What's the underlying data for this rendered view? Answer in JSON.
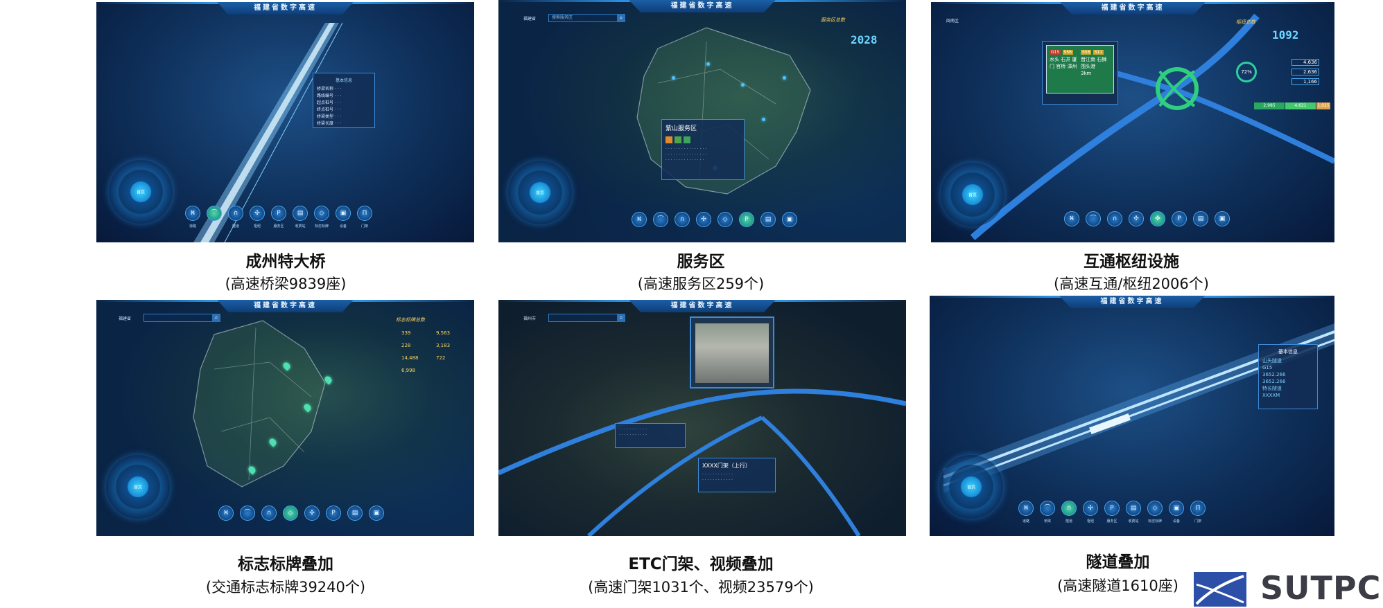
{
  "app_title": "福建省数字高速",
  "panels": [
    {
      "caption_title": "成州特大桥",
      "caption_sub": "(高速桥梁9839座)",
      "toolbar": [
        "道路",
        "桥梁",
        "隧道",
        "枢纽",
        "服务区",
        "收费站",
        "标志标牌",
        "设备",
        "门架"
      ]
    },
    {
      "caption_title": "服务区",
      "caption_sub": "(高速服务区259个)",
      "region": "福建省",
      "search_placeholder": "搜索服务区",
      "stat_title": "服务区总数",
      "stat_value": "2028",
      "popup_title": "紫山服务区"
    },
    {
      "caption_title": "互通枢纽设施",
      "caption_sub": "(高速互通/枢纽2006个)",
      "region": "闽南区",
      "stat_title": "枢纽总数",
      "stat_value": "1092",
      "sign_codes": [
        "G15",
        "S56",
        "S58",
        "S11"
      ],
      "sign_text_left": "水头 石井 厦门 官桥 漳州",
      "sign_text_right": "晋江南 石狮 围头港",
      "sign_distance": "3km",
      "gauge": "72%",
      "counts": [
        "4,636",
        "2,636",
        "1,166"
      ],
      "bottom_bars": [
        "2,985",
        "4,621",
        "1,025"
      ]
    },
    {
      "caption_title": "标志标牌叠加",
      "caption_sub": "(交通标志标牌39240个)",
      "region": "福建省",
      "stat_title": "标志标牌总数",
      "stats": [
        "339",
        "9,563",
        "228",
        "3,183",
        "14,488",
        "722",
        "6,998"
      ]
    },
    {
      "caption_title": "ETC门架、视频叠加",
      "caption_sub": "(高速门架1031个、视频23579个)",
      "region": "福州市",
      "gantry_label": "XXXX门架（上行）"
    },
    {
      "caption_title": "隧道叠加",
      "caption_sub": "(高速隧道1610座)",
      "info_title": "基本信息",
      "info_lines": [
        "山头隧道",
        "G15",
        "3652.266",
        "3652.266",
        "特长隧道",
        "XXXXM"
      ],
      "toolbar": [
        "道路",
        "桥梁",
        "隧道",
        "枢纽",
        "服务区",
        "收费站",
        "标志标牌",
        "设备",
        "门架"
      ]
    }
  ],
  "logo_text": "SUTPC"
}
